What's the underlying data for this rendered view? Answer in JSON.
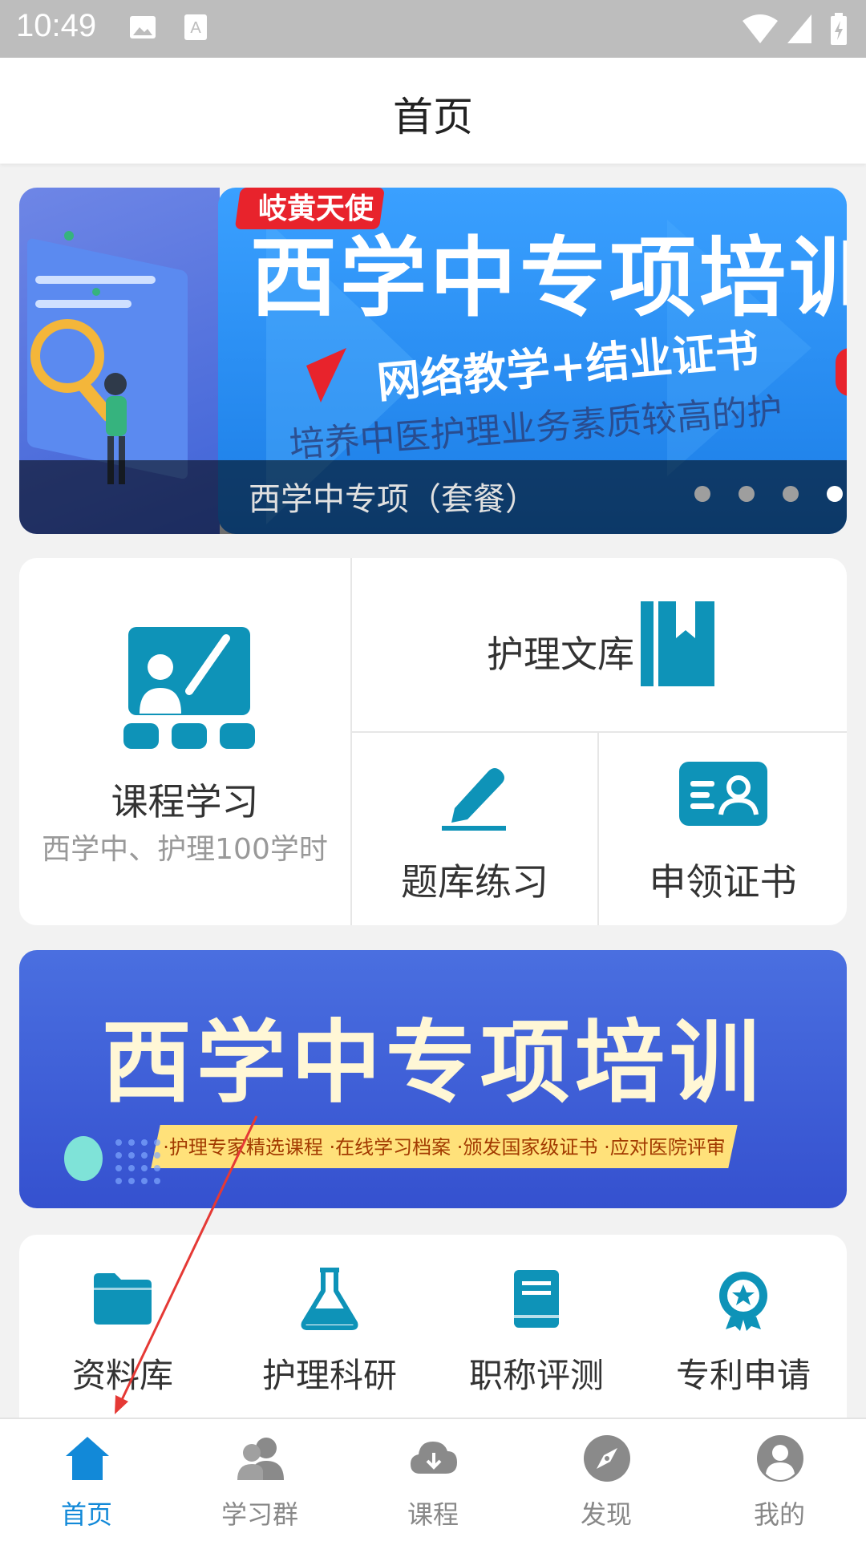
{
  "status_bar": {
    "time": "10:49"
  },
  "header": {
    "title": "首页"
  },
  "banner": {
    "caption": "西学中专项（套餐）",
    "slide_tag": "岐黄天使",
    "slide_title": "西学中专项培训",
    "slide_subtitle": "网络教学+结业证书",
    "slide_bg_text": "培养中医护理业务素质较高的护",
    "dots": 4,
    "active_dot": 4
  },
  "grid": {
    "course": {
      "label": "课程学习",
      "sub": "西学中、护理100学时"
    },
    "library": {
      "label": "护理文库"
    },
    "practice": {
      "label": "题库练习"
    },
    "certificate": {
      "label": "申领证书"
    }
  },
  "promo": {
    "title": "西学中专项培训",
    "ribbon": "·护理专家精选课程 ·在线学习档案 ·颁发国家级证书 ·应对医院评审"
  },
  "shortcuts": [
    {
      "label": "资料库",
      "icon": "folder-icon"
    },
    {
      "label": "护理科研",
      "icon": "flask-icon"
    },
    {
      "label": "职称评测",
      "icon": "book-icon"
    },
    {
      "label": "专利申请",
      "icon": "award-icon"
    }
  ],
  "bottom_nav": [
    {
      "label": "首页",
      "icon": "home-icon",
      "active": true
    },
    {
      "label": "学习群",
      "icon": "group-icon",
      "active": false
    },
    {
      "label": "课程",
      "icon": "cloud-icon",
      "active": false
    },
    {
      "label": "发现",
      "icon": "compass-icon",
      "active": false
    },
    {
      "label": "我的",
      "icon": "person-icon",
      "active": false
    }
  ],
  "colors": {
    "accent": "#1289d8",
    "icon_teal": "#0e93b8",
    "nav_inactive": "#888888"
  }
}
